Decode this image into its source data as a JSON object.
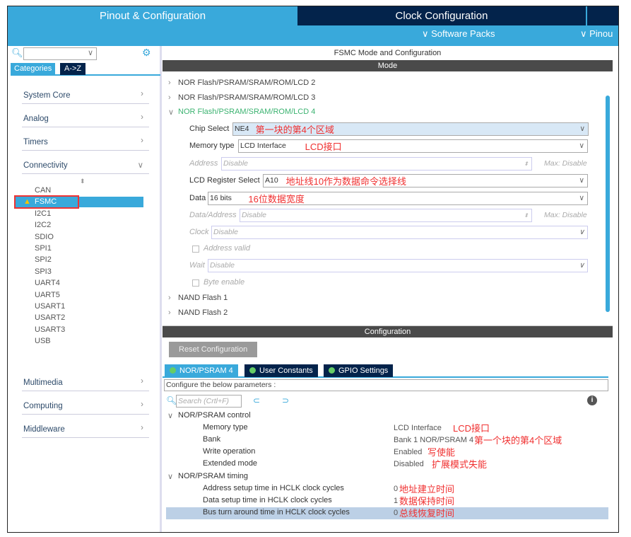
{
  "tabs": {
    "pinout": "Pinout & Configuration",
    "clock": "Clock Configuration",
    "software_packs": "∨ Software Packs",
    "pinout_menu": "∨ Pinou"
  },
  "sidebar": {
    "search_placeholder": "",
    "tab_categories": "Categories",
    "tab_az": "A->Z",
    "categories": [
      {
        "label": "System Core",
        "chev": "›"
      },
      {
        "label": "Analog",
        "chev": "›"
      },
      {
        "label": "Timers",
        "chev": "›"
      },
      {
        "label": "Connectivity",
        "chev": "∨"
      }
    ],
    "peripherals": [
      "CAN",
      "FSMC",
      "I2C1",
      "I2C2",
      "SDIO",
      "SPI1",
      "SPI2",
      "SPI3",
      "UART4",
      "UART5",
      "USART1",
      "USART2",
      "USART3",
      "USB"
    ],
    "bottom_categories": [
      {
        "label": "Multimedia",
        "chev": "›"
      },
      {
        "label": "Computing",
        "chev": "›"
      },
      {
        "label": "Middleware",
        "chev": "›"
      }
    ]
  },
  "mode": {
    "title": "FSMC Mode and Configuration",
    "header": "Mode",
    "tree": [
      "NOR Flash/PSRAM/SRAM/ROM/LCD 2",
      "NOR Flash/PSRAM/SRAM/ROM/LCD 3",
      "NOR Flash/PSRAM/SRAM/ROM/LCD 4"
    ],
    "chip_select": {
      "label": "Chip Select",
      "value": "NE4",
      "note": "第一块的第4个区域"
    },
    "memory_type": {
      "label": "Memory type",
      "value": "LCD Interface",
      "note": "LCD接口"
    },
    "address": {
      "label": "Address",
      "value": "Disable",
      "max": "Max: Disable"
    },
    "lcd_register": {
      "label": "LCD Register Select",
      "value": "A10",
      "note": "地址线10作为数据命令选择线"
    },
    "data": {
      "label": "Data",
      "value": "16 bits",
      "note": "16位数据宽度"
    },
    "data_address": {
      "label": "Data/Address",
      "value": "Disable",
      "max": "Max: Disable"
    },
    "clock": {
      "label": "Clock",
      "value": "Disable"
    },
    "address_valid": "Address valid",
    "wait": {
      "label": "Wait",
      "value": "Disable"
    },
    "byte_enable": "Byte enable",
    "nand": [
      "NAND Flash 1",
      "NAND Flash 2"
    ]
  },
  "config": {
    "header": "Configuration",
    "reset": "Reset Configuration",
    "tabs": [
      "NOR/PSRAM 4",
      "User Constants",
      "GPIO Settings"
    ],
    "configure_text": "Configure the below parameters :",
    "search_placeholder": "Search (Crtl+F)",
    "group1": "NOR/PSRAM control",
    "group2": "NOR/PSRAM timing",
    "params": [
      {
        "label": "Memory type",
        "value": "LCD Interface",
        "note": "LCD接口"
      },
      {
        "label": "Bank",
        "value": "Bank 1 NOR/PSRAM 4",
        "note": "第一个块的第4个区域"
      },
      {
        "label": "Write operation",
        "value": "Enabled",
        "note": "写使能"
      },
      {
        "label": "Extended mode",
        "value": "Disabled",
        "note": "扩展模式失能"
      },
      {
        "label": "Address setup time in HCLK clock cycles",
        "value": "0",
        "note": "地址建立时间"
      },
      {
        "label": "Data setup time in HCLK clock cycles",
        "value": "1",
        "note": "数据保持时间"
      },
      {
        "label": "Bus turn around time in HCLK clock cycles",
        "value": "0",
        "note": "总线恢复时间"
      }
    ]
  }
}
